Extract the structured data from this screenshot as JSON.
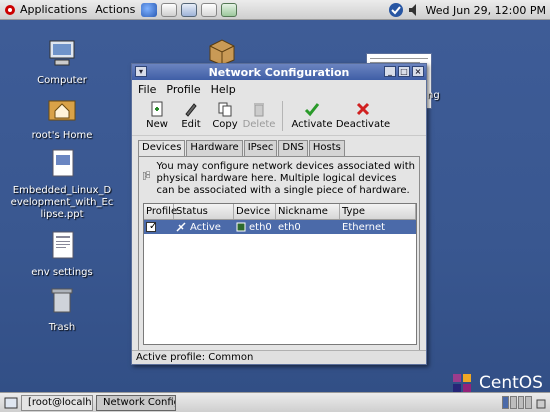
{
  "top_panel": {
    "applications": "Applications",
    "actions": "Actions",
    "clock": "Wed Jun 29, 12:00 PM"
  },
  "desktop": {
    "icons": [
      {
        "label": "Computer"
      },
      {
        "label": "root's Home"
      },
      {
        "label": "Embedded_Linux_Development_with_Eclipse.ppt"
      },
      {
        "label": "env settings"
      },
      {
        "label": "Trash"
      }
    ],
    "partial_label": "ng",
    "brand": "CentOS"
  },
  "window": {
    "title": "Network Configuration",
    "menu": {
      "file": "File",
      "profile": "Profile",
      "help": "Help"
    },
    "toolbar": {
      "new": "New",
      "edit": "Edit",
      "copy": "Copy",
      "delete": "Delete",
      "activate": "Activate",
      "deactivate": "Deactivate"
    },
    "tabs": {
      "devices": "Devices",
      "hardware": "Hardware",
      "ipsec": "IPsec",
      "dns": "DNS",
      "hosts": "Hosts"
    },
    "info_text": "You may configure network devices associated with physical hardware here.  Multiple logical devices can be associated with a single piece of hardware.",
    "table": {
      "headers": {
        "profile": "Profile",
        "status": "Status",
        "device": "Device",
        "nickname": "Nickname",
        "type": "Type"
      },
      "rows": [
        {
          "profile_checked": true,
          "status": "Active",
          "device": "eth0",
          "nickname": "eth0",
          "type": "Ethernet"
        }
      ]
    },
    "status_bar": "Active profile: Common"
  },
  "taskbar": {
    "tasks": [
      {
        "label": "[root@localhost"
      },
      {
        "label": "Network Config"
      }
    ]
  },
  "colors": {
    "selection": "#4b6aa9",
    "titlebar": "#3f5ea6",
    "desktop": "#3d5a93"
  }
}
